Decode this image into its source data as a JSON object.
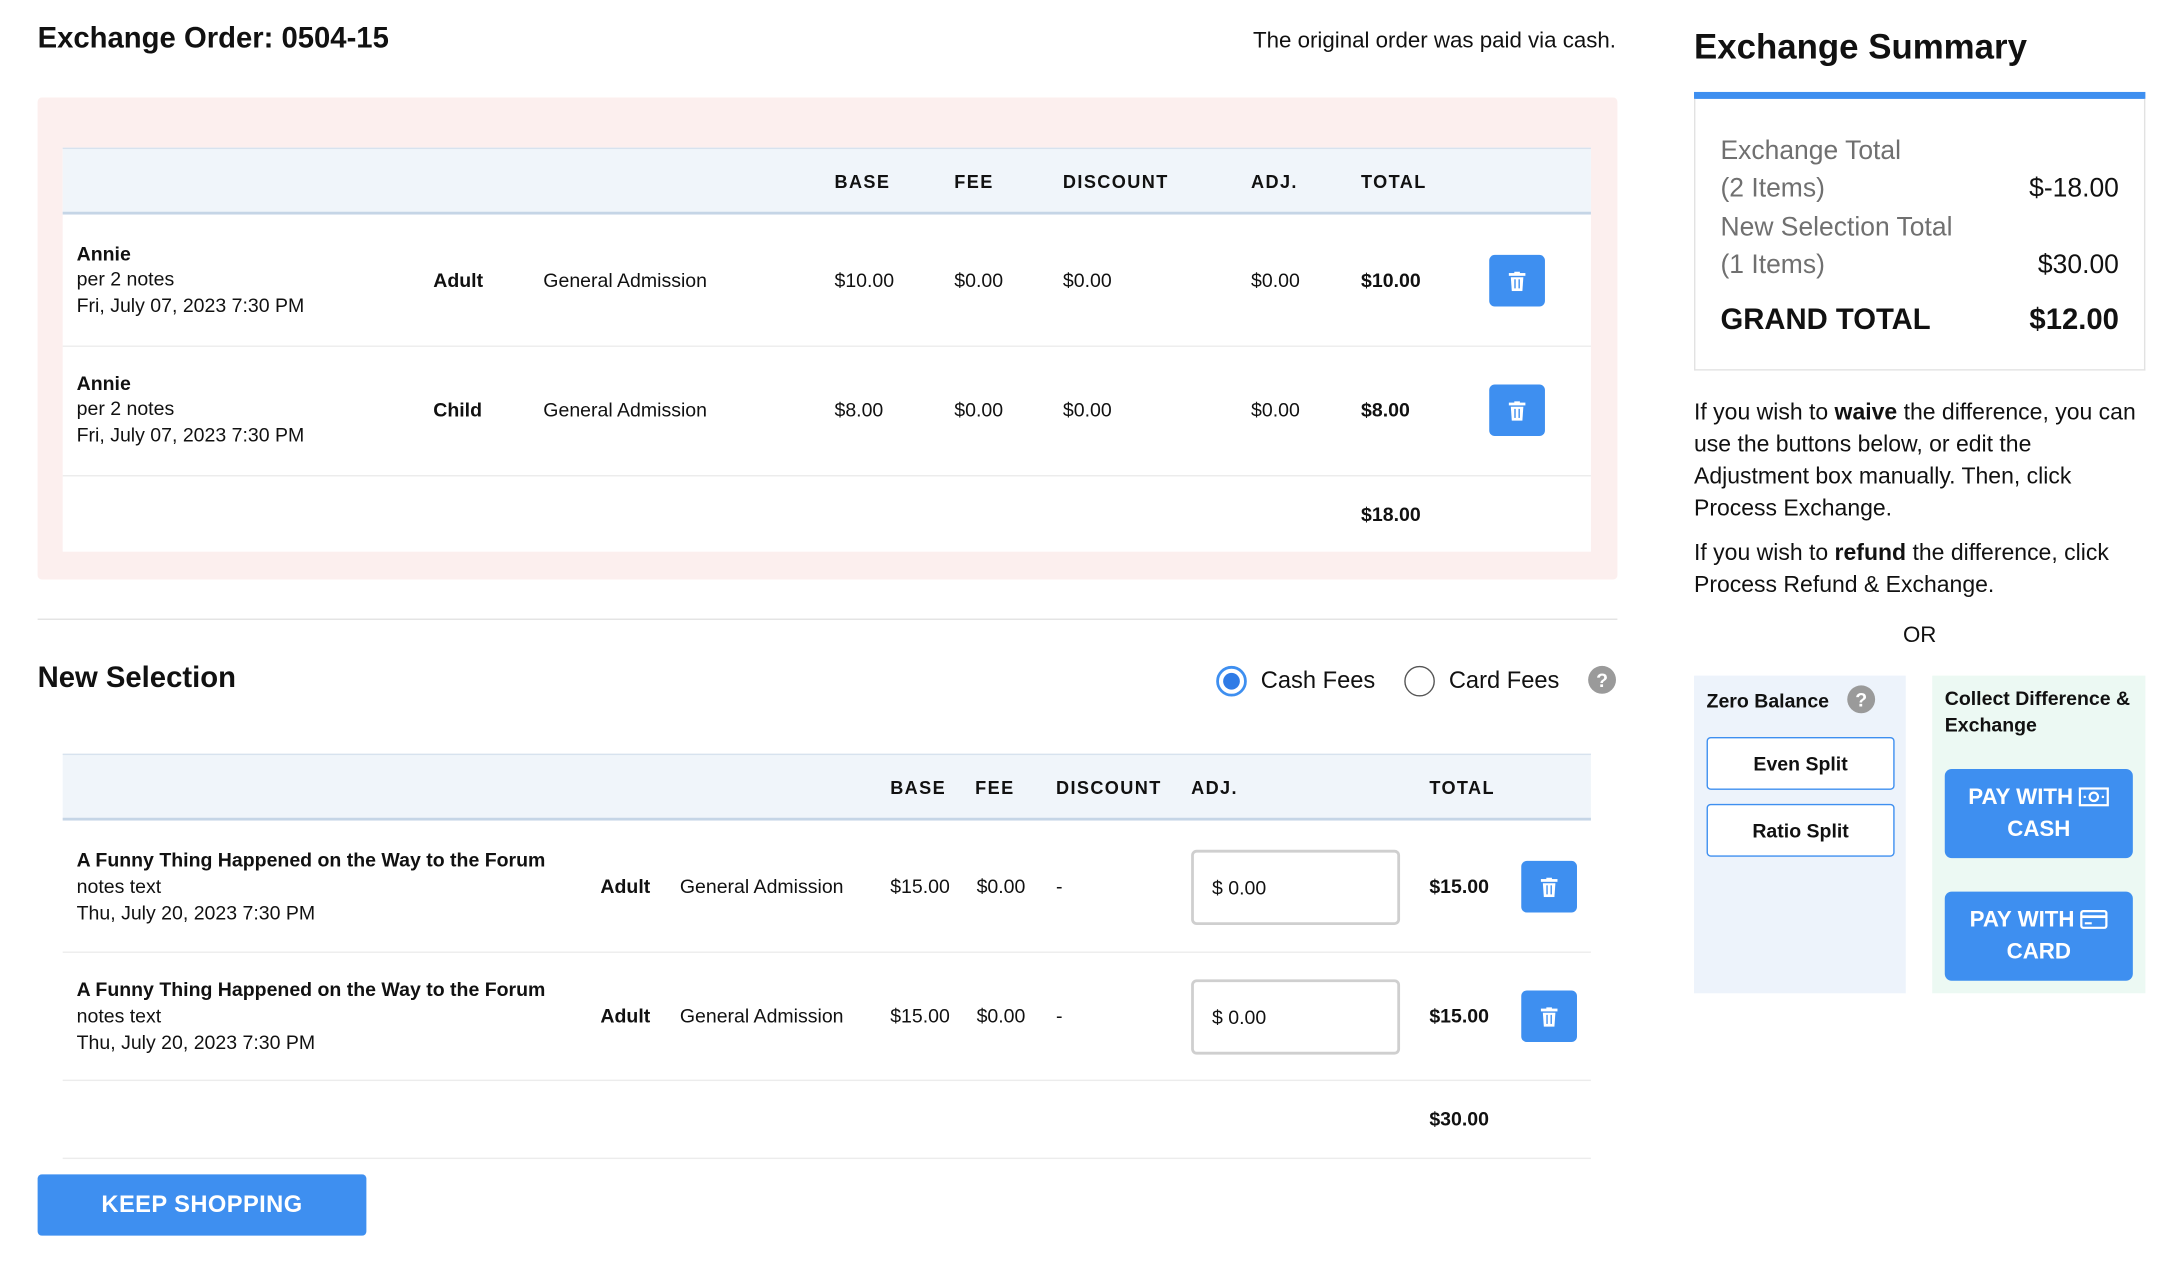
{
  "header": {
    "title": "Exchange Order: 0504-15",
    "paid_note": "The original order was paid via cash."
  },
  "exchange_table": {
    "columns": [
      "BASE",
      "FEE",
      "DISCOUNT",
      "ADJ.",
      "TOTAL"
    ],
    "rows": [
      {
        "name": "Annie",
        "notes": "per 2 notes",
        "date": "Fri, July 07, 2023 7:30 PM",
        "type": "Adult",
        "section": "General Admission",
        "base": "$10.00",
        "fee": "$0.00",
        "discount": "$0.00",
        "adj": "$0.00",
        "total": "$10.00"
      },
      {
        "name": "Annie",
        "notes": "per 2 notes",
        "date": "Fri, July 07, 2023 7:30 PM",
        "type": "Child",
        "section": "General Admission",
        "base": "$8.00",
        "fee": "$0.00",
        "discount": "$0.00",
        "adj": "$0.00",
        "total": "$8.00"
      }
    ],
    "subtotal": "$18.00"
  },
  "new_selection": {
    "title": "New Selection",
    "cash_fees_label": "Cash Fees",
    "card_fees_label": "Card Fees",
    "selected_fee": "Cash Fees",
    "help": "?",
    "columns": [
      "BASE",
      "FEE",
      "DISCOUNT",
      "ADJ.",
      "TOTAL"
    ],
    "rows": [
      {
        "name": "A Funny Thing Happened on the Way to the Forum",
        "notes": "notes text",
        "date": "Thu, July 20, 2023 7:30 PM",
        "type": "Adult",
        "section": "General Admission",
        "base": "$15.00",
        "fee": "$0.00",
        "discount": "-",
        "adj": "$ 0.00",
        "total": "$15.00"
      },
      {
        "name": "A Funny Thing Happened on the Way to the Forum",
        "notes": "notes text",
        "date": "Thu, July 20, 2023 7:30 PM",
        "type": "Adult",
        "section": "General Admission",
        "base": "$15.00",
        "fee": "$0.00",
        "discount": "-",
        "adj": "$ 0.00",
        "total": "$15.00"
      }
    ],
    "subtotal": "$30.00",
    "keep_shopping": "KEEP SHOPPING"
  },
  "summary": {
    "title": "Exchange Summary",
    "exchange_total_label_1": "Exchange Total",
    "exchange_total_label_2": "(2 Items)",
    "exchange_total_value": "$-18.00",
    "new_total_label_1": "New Selection Total",
    "new_total_label_2": "(1 Items)",
    "new_total_value": "$30.00",
    "grand_label": "GRAND TOTAL",
    "grand_value": "$12.00",
    "waive_pre": "If you wish to ",
    "waive_word": "waive",
    "waive_post": " the difference, you can use the buttons below, or edit the Adjustment box manually. Then, click Process Exchange.",
    "refund_pre": "If you wish to ",
    "refund_word": "refund",
    "refund_post": " the difference, click Process Refund & Exchange.",
    "or": "OR",
    "zero_balance": "Zero Balance",
    "even_split": "Even Split",
    "ratio_split": "Ratio Split",
    "collect_title": "Collect Difference & Exchange",
    "pay_cash_1": "PAY WITH",
    "pay_cash_2": "CASH",
    "pay_card_1": "PAY WITH",
    "pay_card_2": "CARD"
  },
  "colors": {
    "accent": "#3e8ff0",
    "exchange_bg": "#fcefee",
    "header_bg": "#f0f5fa"
  }
}
